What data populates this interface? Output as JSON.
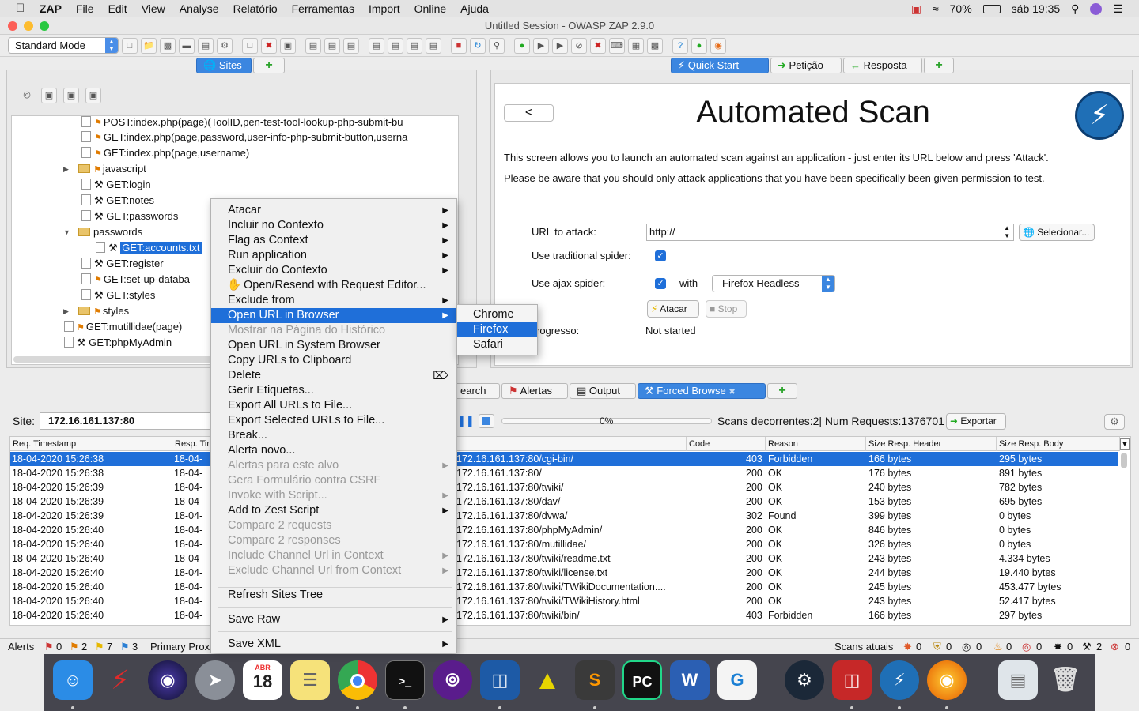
{
  "menubar": {
    "app": "ZAP",
    "items": [
      "File",
      "Edit",
      "View",
      "Analyse",
      "Relatório",
      "Ferramentas",
      "Import",
      "Online",
      "Ajuda"
    ],
    "battery": "70%",
    "clock": "sáb 19:35"
  },
  "window": {
    "title": "Untitled Session - OWASP ZAP 2.9.0"
  },
  "toolbar": {
    "mode": "Standard Mode"
  },
  "sites_tab": {
    "label": "Sites"
  },
  "tree": {
    "items": [
      {
        "label": "POST:index.php(page)(ToolID,pen-test-tool-lookup-php-submit-bu"
      },
      {
        "label": "GET:index.php(page,password,user-info-php-submit-button,userna"
      },
      {
        "label": "GET:index.php(page,username)"
      },
      {
        "label": "javascript"
      },
      {
        "label": "GET:login"
      },
      {
        "label": "GET:notes"
      },
      {
        "label": "GET:passwords"
      },
      {
        "label": "passwords"
      },
      {
        "label": "GET:accounts.txt"
      },
      {
        "label": "GET:register"
      },
      {
        "label": "GET:set-up-databa"
      },
      {
        "label": "GET:styles"
      },
      {
        "label": "styles"
      },
      {
        "label": "GET:mutillidae(page)"
      },
      {
        "label": "GET:phpMyAdmin"
      }
    ]
  },
  "right_tabs": {
    "quick_start": "Quick Start",
    "request": "Petição",
    "response": "Resposta"
  },
  "quickstart": {
    "back": "<",
    "title": "Automated Scan",
    "desc1": "This screen allows you to launch an automated scan against  an application - just enter its URL below and press 'Attack'.",
    "desc2": "Please be aware that you should only attack applications that you have been specifically been given permission to test.",
    "url_label": "URL to attack:",
    "url_value": "http://",
    "select_btn": "Selecionar...",
    "trad_spider": "Use traditional spider:",
    "ajax_spider": "Use ajax spider:",
    "with": "with",
    "browser": "Firefox Headless",
    "attack": "Atacar",
    "stop": "Stop",
    "progress_label": "rogresso:",
    "progress_value": "Not started"
  },
  "bottom_tabs": {
    "search": "earch",
    "alerts": "Alertas",
    "output": "Output",
    "forced": "Forced Browse"
  },
  "scan_bar": {
    "site_label": "Site:",
    "site_value": "172.16.161.137:80",
    "percent": "0%",
    "info": "Scans decorrentes:2| Num Requests:1376701",
    "export": "Exportar"
  },
  "grid": {
    "headers": [
      "Req. Timestamp",
      "Resp. Tir",
      "",
      "Code",
      "Reason",
      "Size Resp. Header",
      "Size Resp. Body"
    ],
    "rows": [
      {
        "ts": "18-04-2020 15:26:38",
        "rt": "18-04-",
        "url": "172.16.161.137:80/cgi-bin/",
        "code": "403",
        "reason": "Forbidden",
        "hdr": "166 bytes",
        "body": "295 bytes"
      },
      {
        "ts": "18-04-2020 15:26:38",
        "rt": "18-04-",
        "url": "172.16.161.137:80/",
        "code": "200",
        "reason": "OK",
        "hdr": "176 bytes",
        "body": "891 bytes"
      },
      {
        "ts": "18-04-2020 15:26:39",
        "rt": "18-04-",
        "url": "172.16.161.137:80/twiki/",
        "code": "200",
        "reason": "OK",
        "hdr": "240 bytes",
        "body": "782 bytes"
      },
      {
        "ts": "18-04-2020 15:26:39",
        "rt": "18-04-",
        "url": "172.16.161.137:80/dav/",
        "code": "200",
        "reason": "OK",
        "hdr": "153 bytes",
        "body": "695 bytes"
      },
      {
        "ts": "18-04-2020 15:26:39",
        "rt": "18-04-",
        "url": "172.16.161.137:80/dvwa/",
        "code": "302",
        "reason": "Found",
        "hdr": "399 bytes",
        "body": "0 bytes"
      },
      {
        "ts": "18-04-2020 15:26:40",
        "rt": "18-04-",
        "url": "172.16.161.137:80/phpMyAdmin/",
        "code": "200",
        "reason": "OK",
        "hdr": "846 bytes",
        "body": "0 bytes"
      },
      {
        "ts": "18-04-2020 15:26:40",
        "rt": "18-04-",
        "url": "172.16.161.137:80/mutillidae/",
        "code": "200",
        "reason": "OK",
        "hdr": "326 bytes",
        "body": "0 bytes"
      },
      {
        "ts": "18-04-2020 15:26:40",
        "rt": "18-04-",
        "url": "172.16.161.137:80/twiki/readme.txt",
        "code": "200",
        "reason": "OK",
        "hdr": "243 bytes",
        "body": "4.334 bytes"
      },
      {
        "ts": "18-04-2020 15:26:40",
        "rt": "18-04-",
        "url": "172.16.161.137:80/twiki/license.txt",
        "code": "200",
        "reason": "OK",
        "hdr": "244 bytes",
        "body": "19.440 bytes"
      },
      {
        "ts": "18-04-2020 15:26:40",
        "rt": "18-04-",
        "url": "172.16.161.137:80/twiki/TWikiDocumentation....",
        "code": "200",
        "reason": "OK",
        "hdr": "245 bytes",
        "body": "453.477 bytes"
      },
      {
        "ts": "18-04-2020 15:26:40",
        "rt": "18-04-",
        "url": "172.16.161.137:80/twiki/TWikiHistory.html",
        "code": "200",
        "reason": "OK",
        "hdr": "243 bytes",
        "body": "52.417 bytes"
      },
      {
        "ts": "18-04-2020 15:26:40",
        "rt": "18-04-",
        "url": "172.16.161.137:80/twiki/bin/",
        "code": "403",
        "reason": "Forbidden",
        "hdr": "166 bytes",
        "body": "297 bytes"
      }
    ]
  },
  "context_menu": {
    "items": [
      {
        "label": "Atacar",
        "sub": true,
        "dis": false
      },
      {
        "label": "Incluir no Contexto",
        "sub": true,
        "dis": false
      },
      {
        "label": "Flag as Context",
        "sub": true,
        "dis": false
      },
      {
        "label": "Run application",
        "sub": true,
        "dis": false
      },
      {
        "label": "Excluir do Contexto",
        "sub": true,
        "dis": false
      },
      {
        "label": "Open/Resend with Request Editor...",
        "sub": false,
        "dis": false
      },
      {
        "label": "Exclude from",
        "sub": true,
        "dis": false
      },
      {
        "label": "Open URL in Browser",
        "sub": true,
        "dis": false
      },
      {
        "label": "Mostrar na Página do Histórico",
        "sub": false,
        "dis": true
      },
      {
        "label": "Open URL in System Browser",
        "sub": false,
        "dis": false
      },
      {
        "label": "Copy URLs to Clipboard",
        "sub": false,
        "dis": false
      },
      {
        "label": "Delete",
        "sub": false,
        "dis": false
      },
      {
        "label": "Gerir Etiquetas...",
        "sub": false,
        "dis": false
      },
      {
        "label": "Export All URLs to File...",
        "sub": false,
        "dis": false
      },
      {
        "label": "Export Selected URLs to File...",
        "sub": false,
        "dis": false
      },
      {
        "label": "Break...",
        "sub": false,
        "dis": false
      },
      {
        "label": "Alerta novo...",
        "sub": false,
        "dis": false
      },
      {
        "label": "Alertas para este alvo",
        "sub": true,
        "dis": true
      },
      {
        "label": "Gera Formulário contra CSRF",
        "sub": false,
        "dis": true
      },
      {
        "label": "Invoke with Script...",
        "sub": true,
        "dis": true
      },
      {
        "label": "Add to Zest Script",
        "sub": true,
        "dis": false
      },
      {
        "label": "Compare 2 requests",
        "sub": false,
        "dis": true
      },
      {
        "label": "Compare 2 responses",
        "sub": false,
        "dis": true
      },
      {
        "label": "Include Channel Url in Context",
        "sub": true,
        "dis": true
      },
      {
        "label": "Exclude Channel Url from Context",
        "sub": true,
        "dis": true
      }
    ],
    "refresh": "Refresh Sites Tree",
    "save_raw": "Save Raw",
    "save_xml": "Save XML"
  },
  "submenu": {
    "items": [
      "Chrome",
      "Firefox",
      "Safari"
    ]
  },
  "statusbar": {
    "alerts": "Alerts",
    "a0": "0",
    "a1": "2",
    "a2": "7",
    "a3": "3",
    "proxy": "Primary Prox",
    "scans": "Scans atuais",
    "s": [
      "0",
      "0",
      "0",
      "0",
      "0",
      "0",
      "2",
      "0"
    ]
  },
  "dock": {
    "calendar_month": "ABR",
    "calendar_day": "18"
  },
  "colors": {
    "accent": "#1f6fd9",
    "tab_blue": "#3b86e0"
  }
}
